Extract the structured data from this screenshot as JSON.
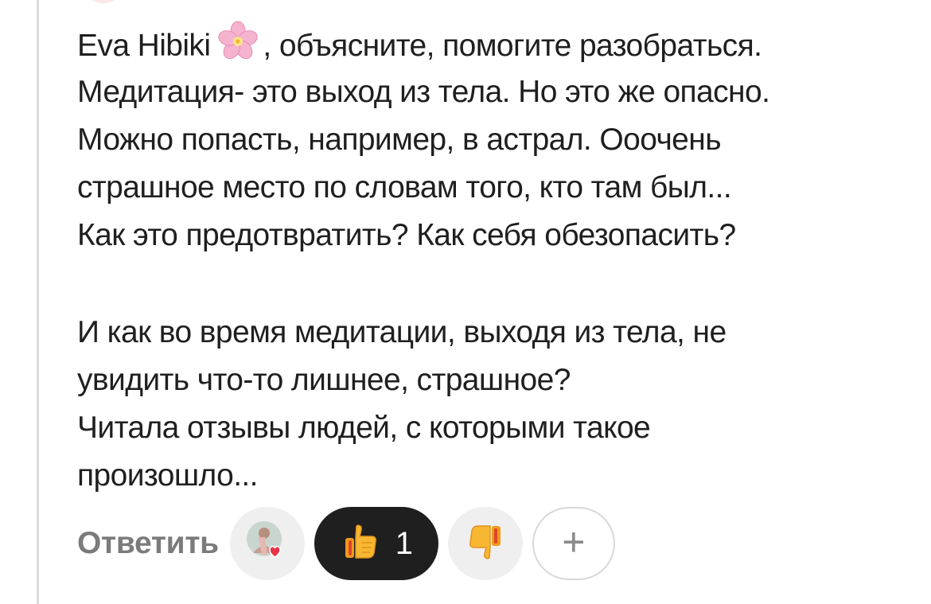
{
  "comment": {
    "author_mention": "Eva Hibiki",
    "mention_emoji": "cherry-blossom-icon",
    "lines": [
      ", объясните, помогите разобраться.",
      "Медитация- это выход из тела. Но это же опасно.",
      "Можно попасть, например, в астрал. Ооочень",
      "страшное место по словам того, кто там был...",
      "Как это предотвратить? Как себя обезопасить?"
    ],
    "paragraph2": [
      "И как во время медитации, выходя из тела, не",
      "увидить что-то лишнее, страшное?",
      "Читала отзывы людей, с которыми такое",
      "произошло..."
    ]
  },
  "actions": {
    "reply_label": "Ответить",
    "reacted_avatar_icon": "user-avatar-heart-icon",
    "like_icon": "thumbs-up-icon",
    "like_count": "1",
    "dislike_icon": "thumbs-down-icon",
    "add_reaction_label": "+"
  },
  "colors": {
    "text": "#1f1f1f",
    "reply": "#7b7b7b",
    "pill_bg": "#efefef",
    "active_pill_bg": "#1f1f1f",
    "emoji_yellow": "#f7b733"
  }
}
